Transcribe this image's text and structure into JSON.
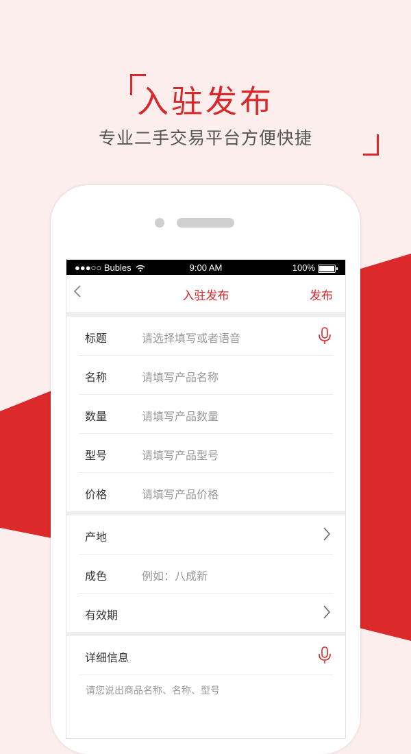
{
  "promo": {
    "title": "入驻发布",
    "subtitle": "专业二手交易平台方便快捷"
  },
  "statusbar": {
    "carrier": "●●●○○ Bubles",
    "time": "9:00 AM",
    "battery": "100%"
  },
  "navbar": {
    "back_icon": "chevron-left-icon",
    "title": "入驻发布",
    "action": "发布"
  },
  "form": {
    "group1": [
      {
        "label": "标题",
        "placeholder": "请选择填写或者语音",
        "icon": "microphone-icon"
      },
      {
        "label": "名称",
        "placeholder": "请填写产品名称"
      },
      {
        "label": "数量",
        "placeholder": "请填写产品数量"
      },
      {
        "label": "型号",
        "placeholder": "请填写产品型号"
      },
      {
        "label": "价格",
        "placeholder": "请填写产品价格"
      }
    ],
    "group2": [
      {
        "label": "产地",
        "icon": "chevron-right-icon"
      },
      {
        "label": "成色",
        "placeholder": "例如：八成新"
      },
      {
        "label": "有效期",
        "icon": "chevron-right-icon"
      }
    ],
    "details": {
      "label": "详细信息",
      "icon": "microphone-icon",
      "placeholder": "请您说出商品名称、名称、型号"
    }
  },
  "colors": {
    "accent": "#d7282b",
    "background": "#fdeeee"
  }
}
